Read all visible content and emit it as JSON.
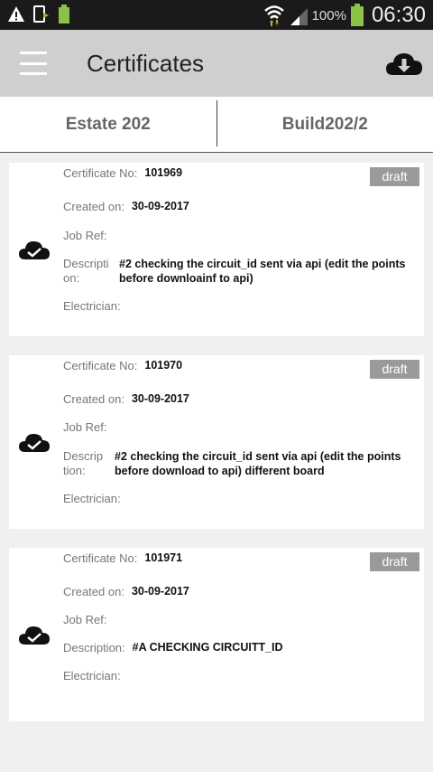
{
  "status_bar": {
    "battery_percent": "100%",
    "time": "06:30",
    "icons": [
      "warning-icon",
      "device-icon",
      "battery-small-icon",
      "wifi-icon",
      "signal-icon",
      "battery-icon"
    ]
  },
  "app_bar": {
    "title": "Certificates",
    "menu_icon": "hamburger-menu-icon",
    "action_icon": "cloud-download-icon"
  },
  "tabs": [
    {
      "label": "Estate 202"
    },
    {
      "label": "Build202/2"
    }
  ],
  "labels": {
    "certificate_no": "Certificate No:",
    "created_on": "Created on:",
    "job_ref": "Job Ref:",
    "electrician": "Electrician:"
  },
  "certificates": [
    {
      "status": "draft",
      "certificate_no": "101969",
      "created_on": "30-09-2017",
      "job_ref": "",
      "description_label_line1": "Descripti",
      "description_label_line2": "on:",
      "description_line1": "#2 checking the circuit_id sent via api (edit the points",
      "description_line2": "before downloainf to api)",
      "electrician": ""
    },
    {
      "status": "draft",
      "certificate_no": "101970",
      "created_on": "30-09-2017",
      "job_ref": "",
      "description_label_line1": "Descrip",
      "description_label_line2": "tion:",
      "description_line1": "#2 checking the circuit_id sent via api (edit the points",
      "description_line2": "before download to api) different board",
      "electrician": ""
    },
    {
      "status": "draft",
      "certificate_no": "101971",
      "created_on": "30-09-2017",
      "job_ref": "",
      "description_label": "Description:",
      "description": "#A CHECKING CIRCUITT_ID",
      "electrician": ""
    }
  ],
  "colors": {
    "status_bar_bg": "#1a1a1a",
    "app_bar_bg": "#cfcfcf",
    "badge_bg": "#9a9a9a",
    "page_bg": "#f0f0f0",
    "battery_green": "#8bc34a"
  }
}
